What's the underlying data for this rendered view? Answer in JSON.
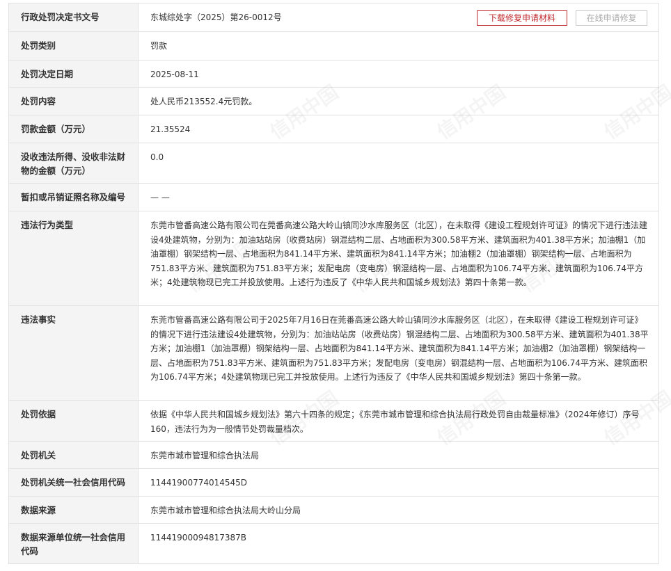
{
  "actions": {
    "download_label": "下载修复申请材料",
    "online_label": "在线申请修复"
  },
  "watermark": "信用中国",
  "rows": [
    {
      "label": "行政处罚决定书文号",
      "value": "东城综处字（2025）第26-0012号"
    },
    {
      "label": "处罚类别",
      "value": "罚款"
    },
    {
      "label": "处罚决定日期",
      "value": "2025-08-11"
    },
    {
      "label": "处罚内容",
      "value": "处人民币213552.4元罚款。"
    },
    {
      "label": "罚款金额（万元）",
      "value": "21.35524"
    },
    {
      "label": "没收违法所得、没收非法财物的金额（万元）",
      "value": "0.0"
    },
    {
      "label": "暂扣或吊销证照名称及编号",
      "value": "— —"
    },
    {
      "label": "违法行为类型",
      "value": "东莞市管番高速公路有限公司在莞番高速公路大岭山镇同沙水库服务区（北区），在未取得《建设工程规划许可证》的情况下进行违法建设4处建筑物，分别为：加油站站房（收费站房）钢混结构二层、占地面积为300.58平方米、建筑面积为401.38平方米；加油棚1（加油罩棚）钢架结构一层、占地面积为841.14平方米、建筑面积为841.14平方米；加油棚2（加油罩棚）钢架结构一层、占地面积为751.83平方米、建筑面积为751.83平方米；发配电房（变电房）钢混结构一层、占地面积为106.74平方米、建筑面积为106.74平方米；4处建筑物现已完工并投放使用。上述行为违反了《中华人民共和国城乡规划法》第四十条第一款。"
    },
    {
      "label": "违法事实",
      "value": "东莞市管番高速公路有限公司于2025年7月16日在莞番高速公路大岭山镇同沙水库服务区（北区），在未取得《建设工程规划许可证》的情况下进行违法建设4处建筑物，分别为：加油站站房（收费站房）钢混结构二层、占地面积为300.58平方米、建筑面积为401.38平方米；加油棚1（加油罩棚）钢架结构一层、占地面积为841.14平方米、建筑面积为841.14平方米；加油棚2（加油罩棚）钢架结构一层、占地面积为751.83平方米、建筑面积为751.83平方米；发配电房（变电房）钢混结构一层、占地面积为106.74平方米、建筑面积为106.74平方米；4处建筑物现已完工并投放使用。上述行为违反了《中华人民共和国城乡规划法》第四十条第一款。"
    },
    {
      "label": "处罚依据",
      "value": "依据《中华人民共和国城乡规划法》第六十四条的规定；《东莞市城市管理和综合执法局行政处罚自由裁量标准》（2024年修订）序号160，违法行为为一般情节处罚裁量档次。"
    },
    {
      "label": "处罚机关",
      "value": "东莞市城市管理和综合执法局"
    },
    {
      "label": "处罚机关统一社会信用代码",
      "value": "11441900774014545D"
    },
    {
      "label": "数据来源",
      "value": "东莞市城市管理和综合执法局大岭山分局"
    },
    {
      "label": "数据来源单位统一社会信用代码",
      "value": "11441900094817387B"
    }
  ]
}
